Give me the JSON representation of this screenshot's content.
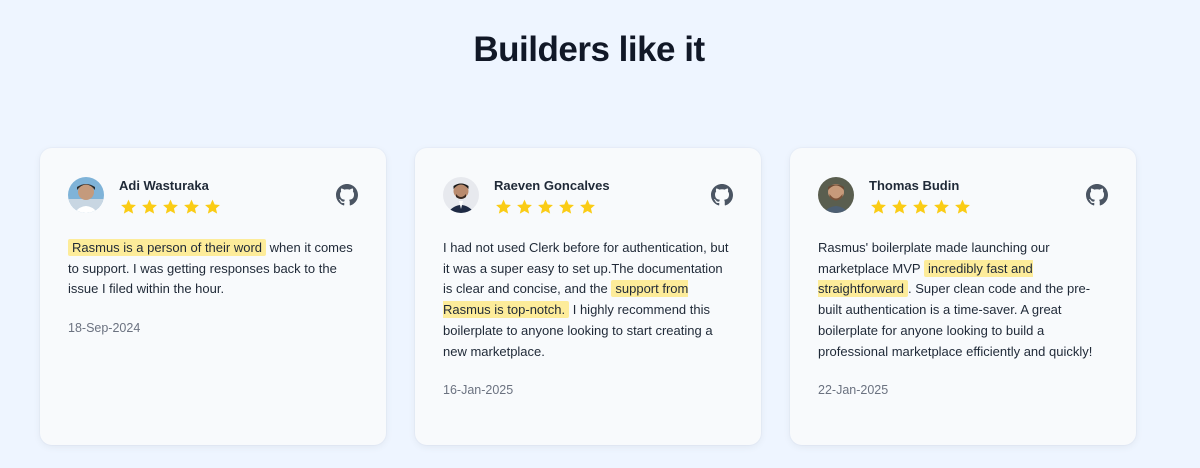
{
  "section": {
    "title": "Builders like it"
  },
  "colors": {
    "star": "#facc15",
    "highlight": "#fdec9a",
    "background": "#eef5ff"
  },
  "reviews": [
    {
      "name": "Adi Wasturaka",
      "rating": 5,
      "source_icon": "github-icon",
      "parts": [
        {
          "text": "Rasmus is a person of their word",
          "highlight": true
        },
        {
          "text": " when it comes to support. I was getting responses back to the issue I filed within the hour.",
          "highlight": false
        }
      ],
      "date": "18-Sep-2024"
    },
    {
      "name": "Raeven Goncalves",
      "rating": 5,
      "source_icon": "github-icon",
      "parts": [
        {
          "text": "I had not used Clerk before for authentication, but it was a super easy to set up.The documentation is clear and concise, and the ",
          "highlight": false
        },
        {
          "text": "support from Rasmus is top-notch.",
          "highlight": true
        },
        {
          "text": " I highly recommend this boilerplate to anyone looking to start creating a new marketplace.",
          "highlight": false
        }
      ],
      "date": "16-Jan-2025"
    },
    {
      "name": "Thomas Budin",
      "rating": 5,
      "source_icon": "github-icon",
      "parts": [
        {
          "text": "Rasmus' boilerplate made launching our marketplace MVP ",
          "highlight": false
        },
        {
          "text": "incredibly fast and straightforward",
          "highlight": true
        },
        {
          "text": ". Super clean code and the pre-built authentication is a time-saver. A great boilerplate for anyone looking to build a professional marketplace efficiently and quickly!",
          "highlight": false
        }
      ],
      "date": "22-Jan-2025"
    }
  ]
}
